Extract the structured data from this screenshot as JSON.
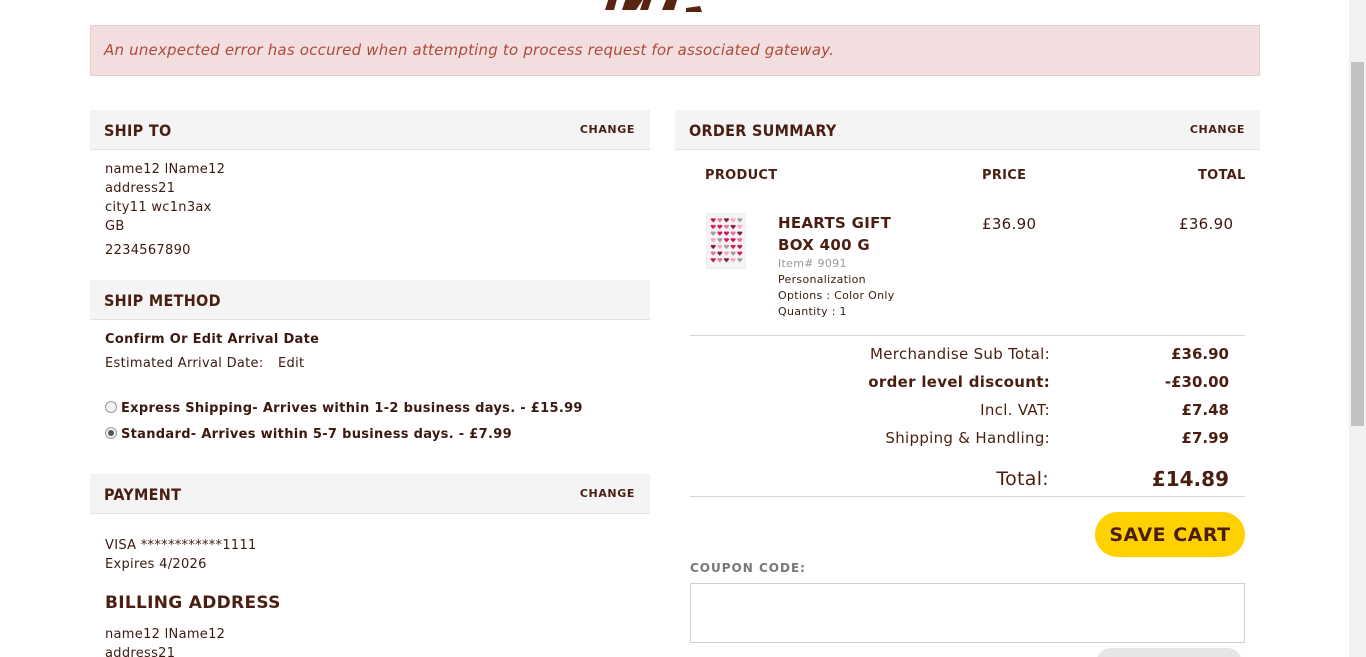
{
  "colors": {
    "brand_brown": "#4a1f12",
    "error_bg": "#f2dede",
    "error_text": "#b04a3a",
    "cta_yellow": "#ffd100",
    "header_bg": "#f4f4f4"
  },
  "error": {
    "message": "An unexpected error has occured when attempting to process request for associated gateway."
  },
  "ship_to": {
    "title": "SHIP TO",
    "change_label": "CHANGE",
    "name": "name12 lName12",
    "address": "address21",
    "city_line": "city11 wc1n3ax",
    "country": "GB",
    "phone": "2234567890"
  },
  "ship_method": {
    "title": "SHIP METHOD",
    "confirm_label": "Confirm Or Edit Arrival Date",
    "estimated_label": "Estimated Arrival Date:",
    "edit_label": "Edit",
    "options": [
      {
        "label": "Express Shipping- Arrives within 1-2 business days.  - £15.99",
        "selected": false
      },
      {
        "label": "Standard- Arrives within 5-7 business days.  - £7.99",
        "selected": true
      }
    ]
  },
  "payment": {
    "title": "PAYMENT",
    "change_label": "CHANGE",
    "card": "VISA ************1111",
    "expires": "Expires 4/2026"
  },
  "billing": {
    "title": "BILLING ADDRESS",
    "name": "name12 lName12",
    "address": "address21"
  },
  "order_summary": {
    "title": "ORDER SUMMARY",
    "change_label": "CHANGE",
    "columns": {
      "product": "PRODUCT",
      "price": "PRICE",
      "total": "TOTAL"
    },
    "item": {
      "name_line1": "HEARTS GIFT",
      "name_line2": "BOX 400 G",
      "item_number": "Item# 9091",
      "personalization": "Personalization",
      "options": "Options : Color Only",
      "quantity": "Quantity : 1",
      "price": "£36.90",
      "total": "£36.90",
      "thumbnail_icon": "hearts-gift-box-image"
    },
    "totals": [
      {
        "label": "Merchandise Sub Total:",
        "value": "£36.90",
        "bold_label": false
      },
      {
        "label": "order level discount:",
        "value": "-£30.00",
        "bold_label": true
      },
      {
        "label": "Incl. VAT:",
        "value": "£7.48",
        "bold_label": false
      },
      {
        "label": "Shipping & Handling:",
        "value": "£7.99",
        "bold_label": false
      }
    ],
    "grand_total_label": "Total:",
    "grand_total_value": "£14.89",
    "save_cart_label": "SAVE CART",
    "coupon_label": "COUPON CODE:",
    "coupon_value": ""
  }
}
